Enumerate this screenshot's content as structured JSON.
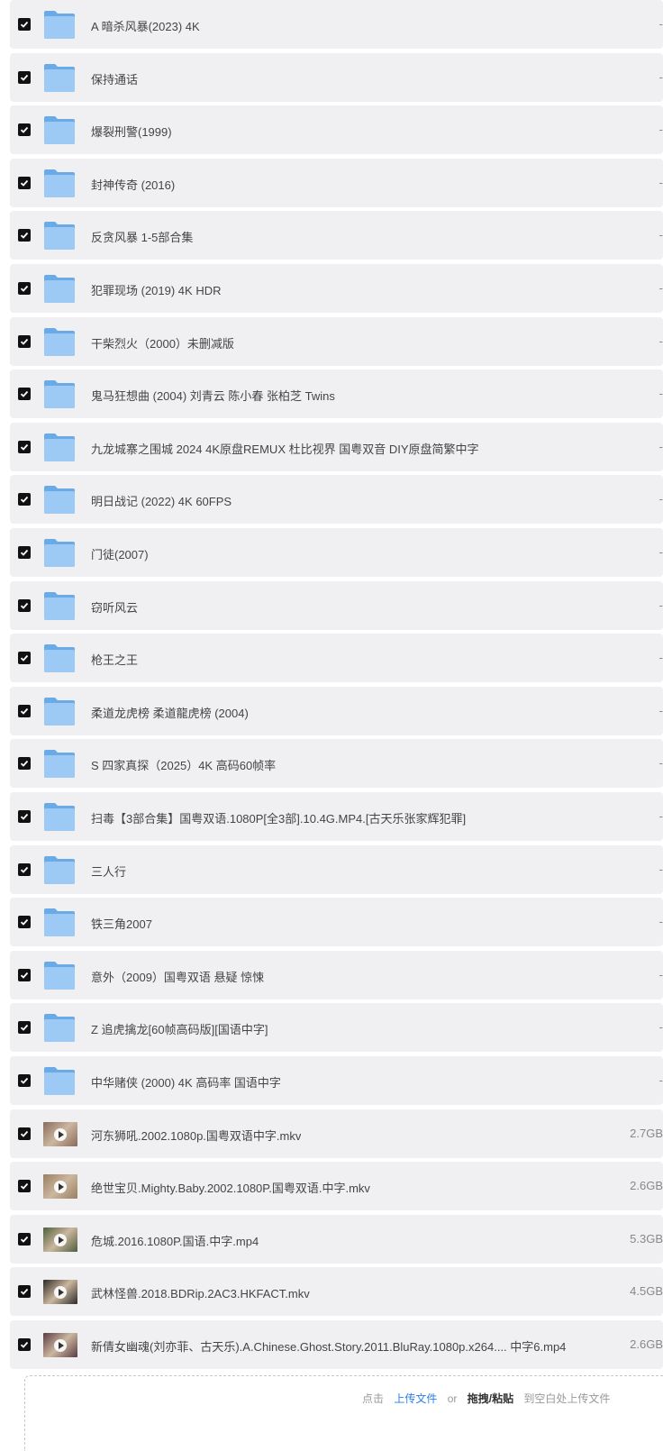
{
  "files": [
    {
      "name": "A 暗杀风暴(2023) 4K",
      "size": "-",
      "type": "folder"
    },
    {
      "name": "保持通话",
      "size": "-",
      "type": "folder"
    },
    {
      "name": "爆裂刑警(1999)",
      "size": "-",
      "type": "folder"
    },
    {
      "name": "封神传奇 (2016)",
      "size": "-",
      "type": "folder"
    },
    {
      "name": "反贪风暴 1-5部合集",
      "size": "-",
      "type": "folder"
    },
    {
      "name": "犯罪现场 (2019) 4K HDR",
      "size": "-",
      "type": "folder"
    },
    {
      "name": "干柴烈火（2000）未删减版",
      "size": "-",
      "type": "folder"
    },
    {
      "name": "鬼马狂想曲 (2004) 刘青云 陈小春 张柏芝 Twins",
      "size": "-",
      "type": "folder"
    },
    {
      "name": "九龙城寨之围城 2024 4K原盘REMUX 杜比视界 国粤双音 DIY原盘简繁中字",
      "size": "-",
      "type": "folder"
    },
    {
      "name": "明日战记 (2022) 4K 60FPS",
      "size": "-",
      "type": "folder"
    },
    {
      "name": "门徒(2007)",
      "size": "-",
      "type": "folder"
    },
    {
      "name": "窃听风云",
      "size": "-",
      "type": "folder"
    },
    {
      "name": "枪王之王",
      "size": "-",
      "type": "folder"
    },
    {
      "name": "柔道龙虎榜 柔道龍虎榜 (2004)",
      "size": "-",
      "type": "folder"
    },
    {
      "name": "S 四家真探（2025）4K 高码60帧率",
      "size": "-",
      "type": "folder"
    },
    {
      "name": "扫毒【3部合集】国粤双语.1080P[全3部].10.4G.MP4.[古天乐张家辉犯罪]",
      "size": "-",
      "type": "folder"
    },
    {
      "name": "三人行",
      "size": "-",
      "type": "folder"
    },
    {
      "name": "铁三角2007",
      "size": "-",
      "type": "folder"
    },
    {
      "name": "意外（2009）国粤双语 悬疑 惊悚",
      "size": "-",
      "type": "folder"
    },
    {
      "name": "Z 追虎擒龙[60帧高码版][国语中字]",
      "size": "-",
      "type": "folder"
    },
    {
      "name": "中华赌侠 (2000) 4K 高码率 国语中字",
      "size": "-",
      "type": "folder"
    },
    {
      "name": "河东狮吼.2002.1080p.国粤双语中字.mkv",
      "size": "2.7GB",
      "type": "video",
      "thumb": "#8a6a5c"
    },
    {
      "name": "绝世宝贝.Mighty.Baby.2002.1080P.国粤双语.中字.mkv",
      "size": "2.6GB",
      "type": "video",
      "thumb": "#9a7f63"
    },
    {
      "name": "危城.2016.1080P.国语.中字.mp4",
      "size": "5.3GB",
      "type": "video",
      "thumb": "#4f5e3d"
    },
    {
      "name": "武林怪兽.2018.BDRip.2AC3.HKFACT.mkv",
      "size": "4.5GB",
      "type": "video",
      "thumb": "#2d2a28"
    },
    {
      "name": "新倩女幽魂(刘亦菲、古天乐).A.Chinese.Ghost.Story.2011.BluRay.1080p.x264....  中字6.mp4",
      "size": "2.6GB",
      "type": "video",
      "thumb": "#5a3c44"
    }
  ],
  "upload": {
    "prefix": "点击",
    "link": "上传文件",
    "or": "or",
    "bold": "拖拽/粘贴",
    "suffix": "到空白处上传文件"
  },
  "colors": {
    "row_bg": "#f0f0f3",
    "folder": "#7fb7ec",
    "link": "#2b7de9",
    "checkbox": "#111111"
  }
}
